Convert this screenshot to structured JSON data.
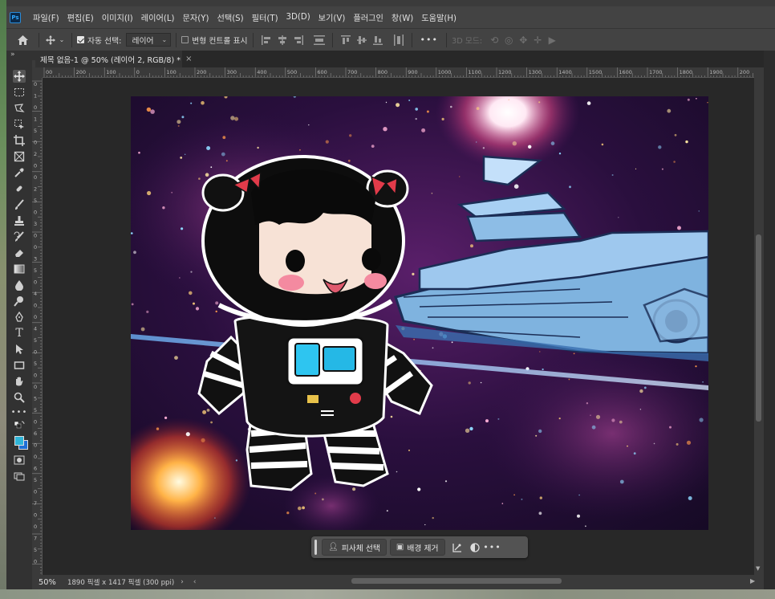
{
  "menubar": {
    "logo": "Ps",
    "items": [
      "파일(F)",
      "편집(E)",
      "이미지(I)",
      "레이어(L)",
      "문자(Y)",
      "선택(S)",
      "필터(T)",
      "3D(D)",
      "보기(V)",
      "플러그인",
      "창(W)",
      "도움말(H)"
    ]
  },
  "options": {
    "auto_select_label": "자동 선택:",
    "auto_select_checked": true,
    "target_value": "레이어",
    "transform_controls_label": "변형 컨트롤 표시",
    "transform_controls_checked": false,
    "more": "•••",
    "mode_3d_label": "3D 모드:"
  },
  "tab": {
    "title": "제목 없음-1 @ 50% (레이어 2, RGB/8) *",
    "close": "×"
  },
  "panel_toggle": "»",
  "ruler": {
    "top": [
      "00",
      "200",
      "100",
      "0",
      "100",
      "200",
      "300",
      "400",
      "500",
      "600",
      "700",
      "800",
      "900",
      "1000",
      "1100",
      "1200",
      "1300",
      "1400",
      "1500",
      "1600",
      "1700",
      "1800",
      "1900",
      "200"
    ],
    "left": [
      "0",
      "1",
      "0",
      "1",
      "5",
      "0",
      "2",
      "0",
      "0",
      "2",
      "5",
      "0",
      "3",
      "0",
      "0",
      "3",
      "5",
      "0",
      "4",
      "0",
      "0",
      "4",
      "5",
      "0",
      "5",
      "0",
      "0",
      "5",
      "5",
      "0",
      "6",
      "0",
      "0",
      "6",
      "5",
      "0",
      "7",
      "0",
      "0",
      "7",
      "5",
      "0"
    ]
  },
  "taskbar": {
    "select_subject": "피사체 선택",
    "remove_background": "배경 제거",
    "more": "•••"
  },
  "status": {
    "zoom": "50%",
    "doc_info": "1890 픽셀 x 1417 픽셀 (300 ppi)",
    "arrow": "›"
  },
  "colors": {
    "foreground": "#2fb5d8",
    "background": "#1f6fd6",
    "ui_panel": "#434343",
    "ui_dark": "#282828"
  }
}
